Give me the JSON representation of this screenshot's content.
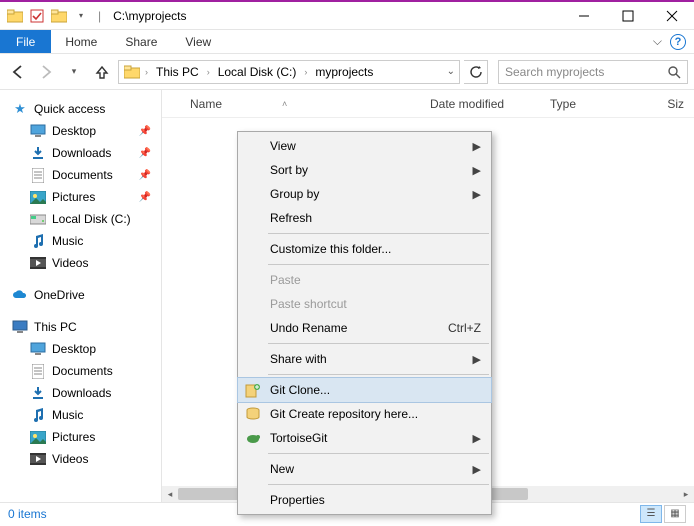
{
  "title": "C:\\myprojects",
  "ribbon": {
    "file": "File",
    "tabs": [
      "Home",
      "Share",
      "View"
    ]
  },
  "breadcrumbs": [
    "This PC",
    "Local Disk (C:)",
    "myprojects"
  ],
  "search": {
    "placeholder": "Search myprojects"
  },
  "columns": {
    "name": "Name",
    "date": "Date modified",
    "type": "Type",
    "size": "Siz"
  },
  "tree": {
    "quick": {
      "label": "Quick access",
      "items": [
        {
          "label": "Desktop",
          "pinned": true,
          "icon": "desktop"
        },
        {
          "label": "Downloads",
          "pinned": true,
          "icon": "download"
        },
        {
          "label": "Documents",
          "pinned": true,
          "icon": "document"
        },
        {
          "label": "Pictures",
          "pinned": true,
          "icon": "pictures"
        },
        {
          "label": "Local Disk (C:)",
          "pinned": false,
          "icon": "disk"
        },
        {
          "label": "Music",
          "pinned": false,
          "icon": "music"
        },
        {
          "label": "Videos",
          "pinned": false,
          "icon": "video"
        }
      ]
    },
    "onedrive": {
      "label": "OneDrive"
    },
    "thispc": {
      "label": "This PC",
      "items": [
        {
          "label": "Desktop",
          "icon": "desktop"
        },
        {
          "label": "Documents",
          "icon": "document"
        },
        {
          "label": "Downloads",
          "icon": "download"
        },
        {
          "label": "Music",
          "icon": "music"
        },
        {
          "label": "Pictures",
          "icon": "pictures"
        },
        {
          "label": "Videos",
          "icon": "video"
        }
      ]
    }
  },
  "ctx": {
    "view": "View",
    "sort": "Sort by",
    "group": "Group by",
    "refresh": "Refresh",
    "customize": "Customize this folder...",
    "paste": "Paste",
    "pastesc": "Paste shortcut",
    "undo": "Undo Rename",
    "undokey": "Ctrl+Z",
    "share": "Share with",
    "gitclone": "Git Clone...",
    "gitcreate": "Git Create repository here...",
    "tortoise": "TortoiseGit",
    "new": "New",
    "props": "Properties"
  },
  "status": {
    "items": "0 items"
  }
}
